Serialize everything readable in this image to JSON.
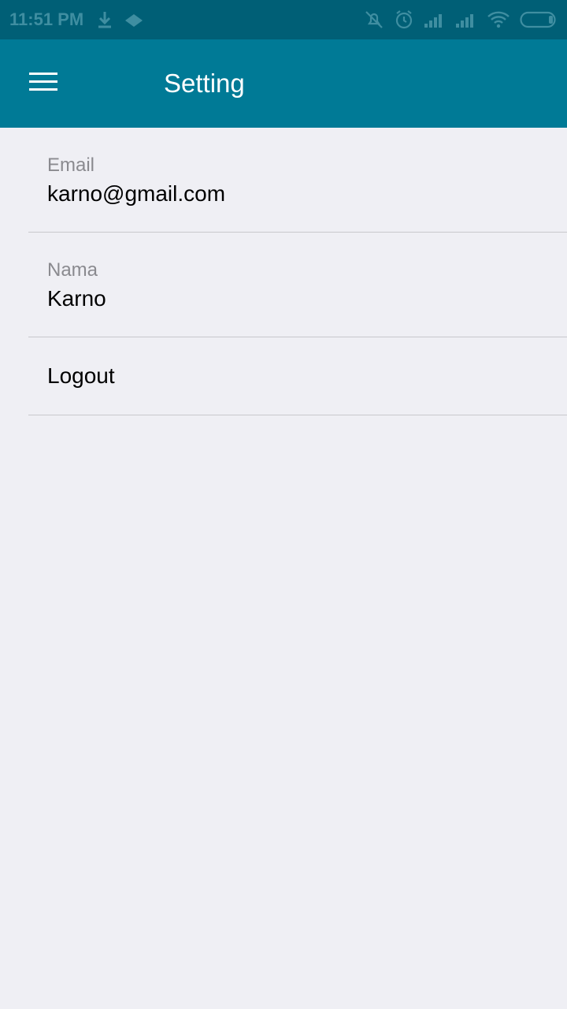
{
  "status_bar": {
    "time": "11:51 PM",
    "left_icons": [
      "download-icon",
      "cloud-icon"
    ],
    "right_icons": [
      "mute-notification-icon",
      "alarm-icon",
      "signal-icon",
      "signal-icon",
      "wifi-icon",
      "battery-icon"
    ]
  },
  "app_bar": {
    "title": "Setting",
    "menu_icon": "hamburger-menu-icon",
    "background": "#007a96"
  },
  "settings": {
    "email": {
      "label": "Email",
      "value": "karno@gmail.com"
    },
    "name": {
      "label": "Nama",
      "value": "Karno"
    },
    "logout": {
      "label": "Logout"
    }
  }
}
